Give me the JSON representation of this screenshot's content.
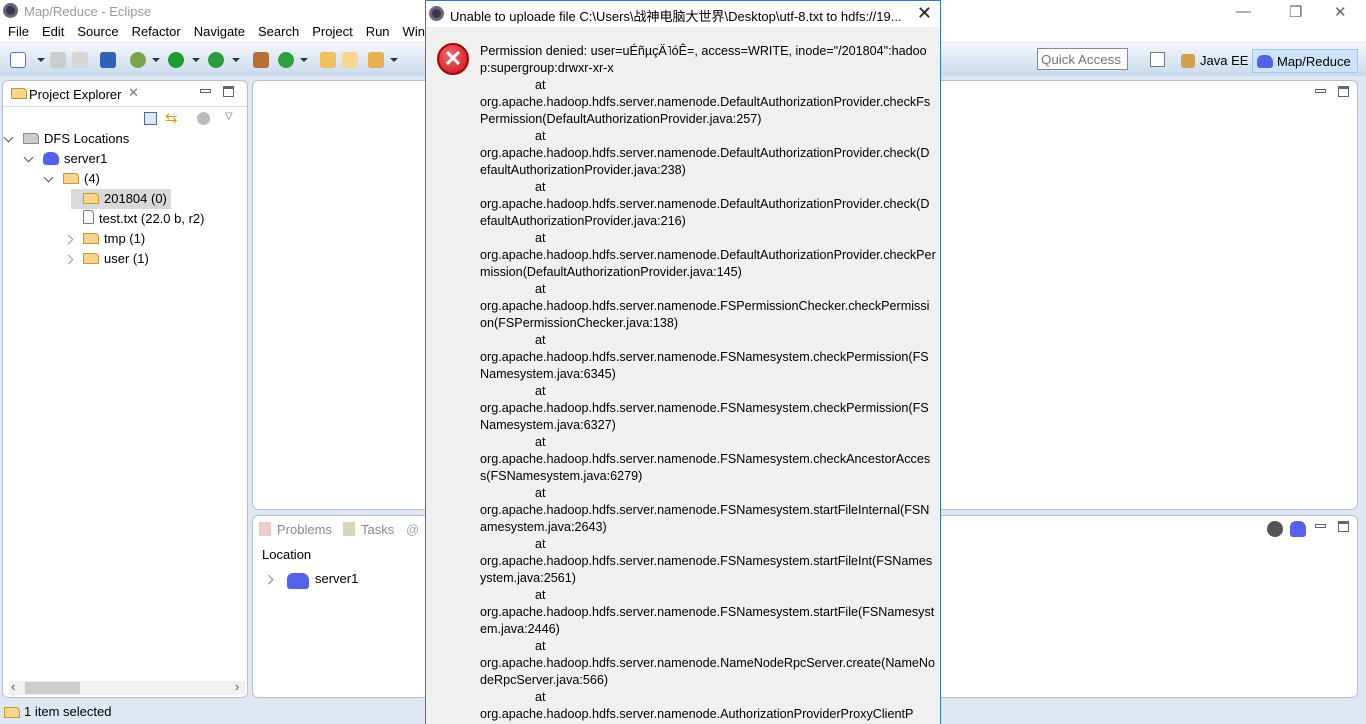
{
  "window": {
    "title": "Map/Reduce - Eclipse"
  },
  "menu": [
    "File",
    "Edit",
    "Source",
    "Refactor",
    "Navigate",
    "Search",
    "Project",
    "Run",
    "Window"
  ],
  "toolbar": {
    "quick_access_placeholder": "Quick Access",
    "perspectives": [
      {
        "label": "Java EE",
        "active": false
      },
      {
        "label": "Map/Reduce",
        "active": true
      }
    ]
  },
  "explorer": {
    "title": "Project Explorer",
    "tree": [
      {
        "label": "DFS Locations",
        "icon": "dfs-icon",
        "expanded": true
      },
      {
        "label": "server1",
        "icon": "elephant-icon",
        "expanded": true
      },
      {
        "label": "(4)",
        "icon": "folder-icon",
        "expanded": true
      },
      {
        "label": "201804 (0)",
        "icon": "folder-icon",
        "selected": true
      },
      {
        "label": "test.txt (22.0 b, r2)",
        "icon": "file-icon"
      },
      {
        "label": "tmp (1)",
        "icon": "folder-icon",
        "expanded": false
      },
      {
        "label": "user (1)",
        "icon": "folder-icon",
        "expanded": false
      }
    ]
  },
  "bottom": {
    "tabs": [
      "Problems",
      "Tasks",
      "@"
    ],
    "column": "Location",
    "rows": [
      {
        "label": "server1"
      }
    ]
  },
  "status": {
    "text": "1 item selected"
  },
  "dialog": {
    "title": "Unable to uploade file C:\\Users\\战神电脑大世界\\Desktop\\utf-8.txt to hdfs://19...",
    "message": "Permission denied: user=uÉñµçÄ˥óÊ=, access=WRITE, inode=\"/201804\":hadoop:supergroup:drwxr-xr-x",
    "at": "at",
    "frames": [
      "org.apache.hadoop.hdfs.server.namenode.DefaultAuthorizationProvider.checkFsPermission(DefaultAuthorizationProvider.java:257)",
      "org.apache.hadoop.hdfs.server.namenode.DefaultAuthorizationProvider.check(DefaultAuthorizationProvider.java:238)",
      "org.apache.hadoop.hdfs.server.namenode.DefaultAuthorizationProvider.check(DefaultAuthorizationProvider.java:216)",
      "org.apache.hadoop.hdfs.server.namenode.DefaultAuthorizationProvider.checkPermission(DefaultAuthorizationProvider.java:145)",
      "org.apache.hadoop.hdfs.server.namenode.FSPermissionChecker.checkPermission(FSPermissionChecker.java:138)",
      "org.apache.hadoop.hdfs.server.namenode.FSNamesystem.checkPermission(FSNamesystem.java:6345)",
      "org.apache.hadoop.hdfs.server.namenode.FSNamesystem.checkPermission(FSNamesystem.java:6327)",
      "org.apache.hadoop.hdfs.server.namenode.FSNamesystem.checkAncestorAccess(FSNamesystem.java:6279)",
      "org.apache.hadoop.hdfs.server.namenode.FSNamesystem.startFileInternal(FSNamesystem.java:2643)",
      "org.apache.hadoop.hdfs.server.namenode.FSNamesystem.startFileInt(FSNamesystem.java:2561)",
      "org.apache.hadoop.hdfs.server.namenode.FSNamesystem.startFile(FSNamesystem.java:2446)",
      "org.apache.hadoop.hdfs.server.namenode.NameNodeRpcServer.create(NameNodeRpcServer.java:566)",
      "org.apache.hadoop.hdfs.server.namenode.AuthorizationProviderProxyClientP"
    ]
  },
  "colors": {
    "accent": "#2b7ad0",
    "error": "#c1121a",
    "toolbar": "#c9d9ec",
    "workbench": "#dfe6f4"
  }
}
